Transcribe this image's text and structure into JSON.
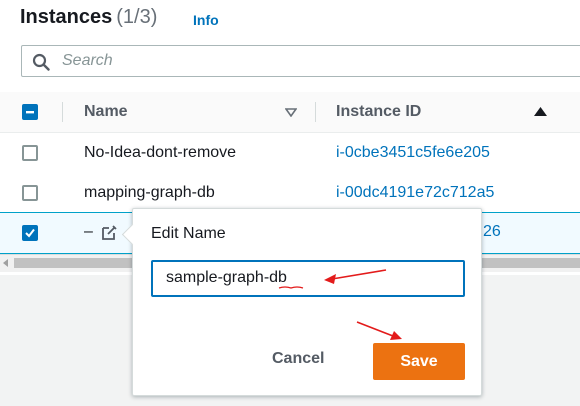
{
  "header": {
    "title": "Instances",
    "count": "(1/3)",
    "info": "Info"
  },
  "search": {
    "placeholder": "Search",
    "icon": "search-icon"
  },
  "table": {
    "columns": [
      {
        "label": "Name",
        "sort": "none"
      },
      {
        "label": "Instance ID",
        "sort": "ascending"
      }
    ],
    "rows": [
      {
        "name": "No-Idea-dont-remove",
        "instance_id": "i-0cbe3451c5fe6e205",
        "checked": false
      },
      {
        "name": "mapping-graph-db",
        "instance_id": "i-00dc4191e72c712a5",
        "checked": false
      },
      {
        "name": "–",
        "instance_id": "26",
        "checked": true
      }
    ]
  },
  "edit_popover": {
    "title": "Edit Name",
    "value": "sample-graph-db",
    "cancel_label": "Cancel",
    "save_label": "Save"
  },
  "colors": {
    "accent": "#0073bb",
    "save": "#ec7211",
    "annotation": "#e31b1b"
  }
}
